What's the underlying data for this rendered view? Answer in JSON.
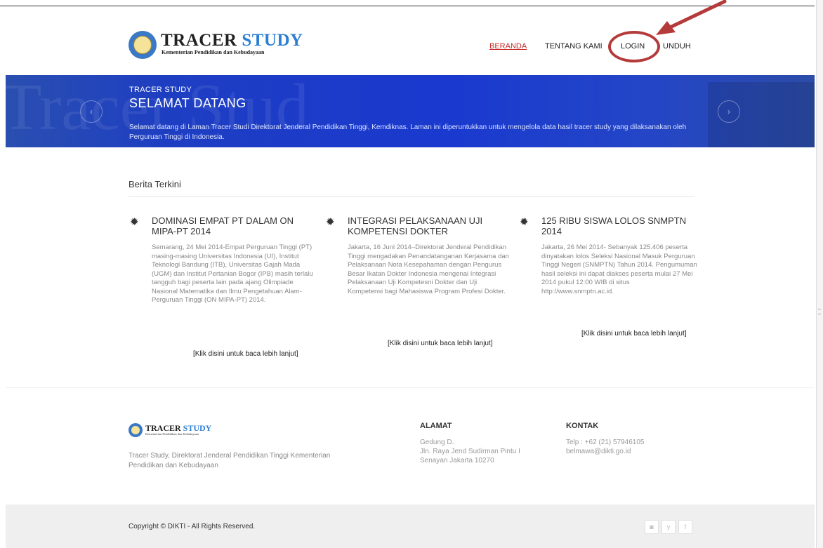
{
  "header": {
    "logo_title_1": "TRACER",
    "logo_title_2": "STUDY",
    "logo_subtitle": "Kementerian Pendidikan dan Kebudayaan",
    "nav": [
      "BERANDA",
      "TENTANG KAMI",
      "LOGIN",
      "UNDUH"
    ],
    "active_nav": "BERANDA"
  },
  "banner": {
    "overline": "TRACER STUDY",
    "title": "SELAMAT DATANG",
    "description": "Selamat datang di Laman Tracer Studi Direktorat Jenderal Pendidikan Tinggi, Kemdiknas. Laman ini diperuntukkan untuk mengelola data hasil tracer study yang dilaksanakan oleh Perguruan Tinggi di Indonesia.",
    "background_text": "Tracer Stud"
  },
  "news": {
    "heading": "Berita Terkini",
    "items": [
      {
        "title": "DOMINASI EMPAT PT DALAM ON MIPA-PT 2014",
        "body": "Semarang, 24 Mei 2014-Empat Perguruan Tinggi (PT) masing-masing Universitas Indonesia (UI), Institut Teknologi Bandung (ITB), Universitas Gajah Mada (UGM) dan Institut Pertanian Bogor (IPB) masih terlalu tangguh bagi peserta lain pada ajang Olimpiade Nasional Matematika dan Ilmu Pengetahuan Alam-Perguruan Tinggi (ON MIPA-PT) 2014.",
        "more": "[Klik disini untuk baca lebih lanjut]"
      },
      {
        "title": "INTEGRASI PELAKSANAAN UJI KOMPETENSI DOKTER",
        "body": "Jakarta, 16 Juni 2014–Direktorat Jenderal Pendidikan Tinggi mengadakan Penandatanganan Kerjasama dan Pelaksanaan Nota Kesepahaman dengan Pengurus Besar Ikatan Dokter Indonesia mengenai Integrasi Pelaksanaan Uji Kompetesni Dokter dan Uji Kompetensi bagi Mahasiswa Program Profesi Dokter.",
        "more": "[Klik disini untuk baca lebih lanjut]"
      },
      {
        "title": "125 RIBU SISWA LOLOS SNMPTN 2014",
        "body": "Jakarta, 26 Mei 2014- Sebanyak 125.406 peserta dinyatakan lolos Seleksi Nasional Masuk Perguruan Tinggi Negeri (SNMPTN) Tahun 2014. Pengumuman hasil seleksi ini dapat diakses peserta mulai 27 Mei 2014 pukul 12:00 WIB di situs http://www.snmptn.ac.id.",
        "more": "[Klik disini untuk baca lebih lanjut]"
      }
    ]
  },
  "footer": {
    "logo_title_1": "TRACER",
    "logo_title_2": "STUDY",
    "logo_subtitle": "Kementerian Pendidikan dan Kebudayaan",
    "description": "Tracer Study, Direktorat Jenderal Pendidikan Tinggi Kementerian Pendidikan dan Kebudayaan",
    "address_heading": "ALAMAT",
    "address_lines": [
      "Gedung D.",
      "Jln. Raya Jend Sudirman Pintu I",
      "Senayan Jakarta 10270"
    ],
    "contact_heading": "KONTAK",
    "contact_lines": [
      "Telp : +62 (21) 57946105",
      "belmawa@dikti.go.id"
    ],
    "copyright": "Copyright © DIKTI - All Rights Reserved.",
    "social_icons": [
      "instagram-icon",
      "twitter-icon",
      "facebook-icon"
    ],
    "social_glyphs": [
      "◙",
      "y",
      "f"
    ]
  },
  "annotation": {
    "highlight_color": "#b53a3a",
    "highlighted": "LOGIN"
  },
  "colors": {
    "banner": "#1e3ec2",
    "active_nav": "#c62828",
    "brand_blue": "#2e7fd3"
  }
}
